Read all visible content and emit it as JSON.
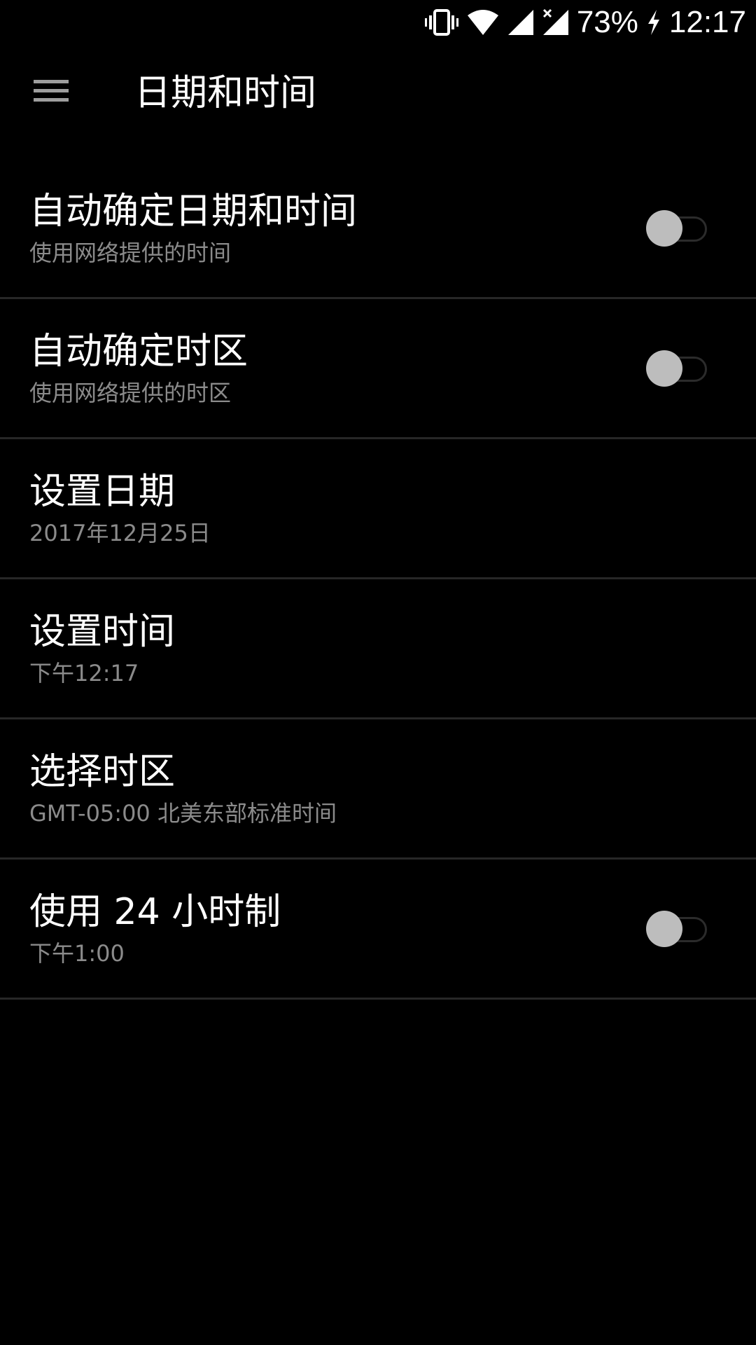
{
  "status_bar": {
    "battery_percent": "73%",
    "time": "12:17",
    "icons": [
      "vibrate-icon",
      "wifi-icon",
      "cell-signal-icon",
      "cell-signal-no-data-icon",
      "charging-icon"
    ]
  },
  "toolbar": {
    "title": "日期和时间",
    "menu_icon": "menu-icon"
  },
  "settings": {
    "items": [
      {
        "title": "自动确定日期和时间",
        "summary": "使用网络提供的时间",
        "switch_on": false
      },
      {
        "title": "自动确定时区",
        "summary": "使用网络提供的时区",
        "switch_on": false
      },
      {
        "title": "设置日期",
        "summary": "2017年12月25日"
      },
      {
        "title": "设置时间",
        "summary": "下午12:17"
      },
      {
        "title": "选择时区",
        "summary": "GMT-05:00 北美东部标准时间"
      },
      {
        "title": "使用 24 小时制",
        "summary": "下午1:00",
        "switch_on": false
      }
    ]
  },
  "colors": {
    "background": "#000000",
    "text_primary": "#ffffff",
    "text_secondary": "#8b8b8b",
    "divider": "#272727",
    "switch_thumb_off": "#bdbdbd"
  }
}
